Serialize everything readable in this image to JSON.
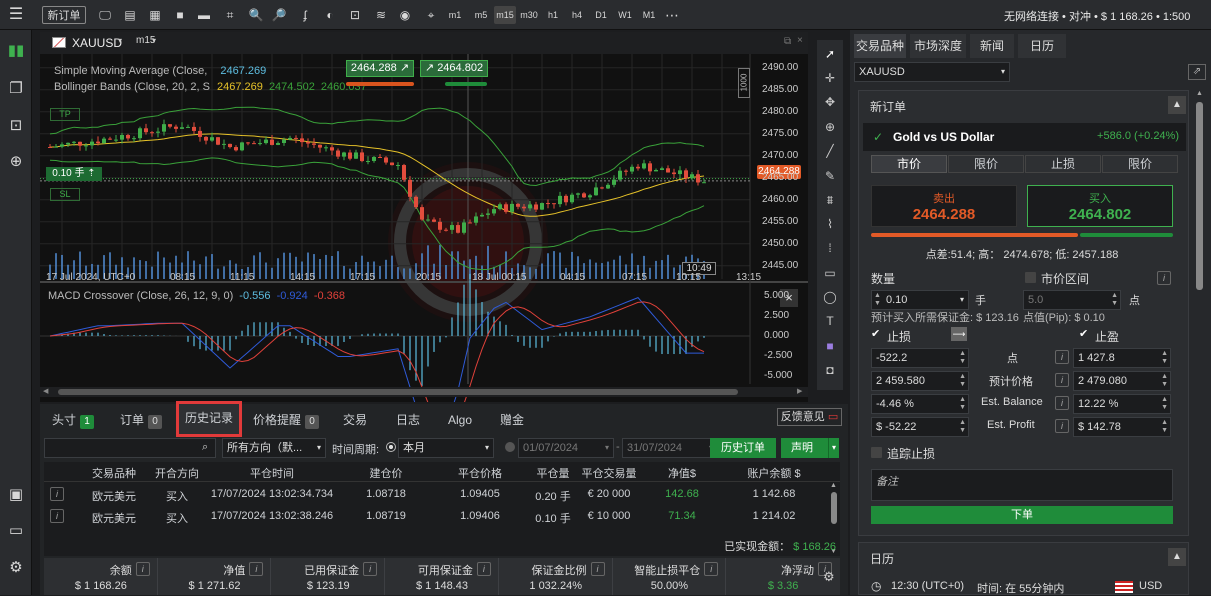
{
  "toolbar": {
    "new_order": "新订单",
    "timeframes": [
      "m1",
      "m5",
      "m15",
      "m30",
      "h1",
      "h4",
      "D1",
      "W1",
      "M1"
    ],
    "more": "⋯",
    "account_status": "无网络连接 • 对冲 • $ 1 168.26 • 1:500"
  },
  "chart": {
    "symbol": "XAUUSD",
    "timeframe": "m15",
    "indicators": {
      "sma": {
        "label": "Simple Moving Average (Close,",
        "value": "2467.269"
      },
      "bb": {
        "label": "Bollinger Bands (Close, 20, 2, S",
        "v1": "2467.269",
        "v2": "2474.502",
        "v3": "2460.037"
      }
    },
    "sell_price": "2464.288",
    "buy_price": "2464.802",
    "qty_label": "0.10 手",
    "tp_label": "TP",
    "sl_label": "SL",
    "current_price_tag": "2464.288",
    "price_scale_label": "1000",
    "y_ticks": [
      "2490.00",
      "2485.00",
      "2480.00",
      "2475.00",
      "2470.00",
      "2465.00",
      "2460.00",
      "2455.00",
      "2450.00",
      "2445.00"
    ],
    "x_ticks": [
      "17 Jul 2024, UTC+0",
      "08:15",
      "11:15",
      "14:15",
      "17:15",
      "20:15",
      "18 Jul 00:15",
      "04:15",
      "07:15",
      "10:15",
      "13:15"
    ],
    "crosshair_time": "10:49",
    "macd": {
      "label": "MACD Crossover (Close, 26, 12, 9, 0)",
      "v1": "-0.556",
      "v2": "-0.924",
      "v3": "-0.368"
    },
    "macd_ticks": [
      "5.000",
      "2.500",
      "0.000",
      "-2.500",
      "-5.000"
    ],
    "colors": {
      "sma": "#e6c229",
      "bb": "#3aa23a",
      "up": "#3fae4a",
      "down": "#e24d3d",
      "macd": "#2f5bd9",
      "signal": "#e0413a",
      "volume": "#4d86c9"
    }
  },
  "bottom": {
    "tabs": [
      {
        "label": "头寸",
        "count": "1"
      },
      {
        "label": "订单",
        "count": "0"
      },
      {
        "label": "历史记录"
      },
      {
        "label": "价格提醒",
        "count": "0"
      },
      {
        "label": "交易"
      },
      {
        "label": "日志"
      },
      {
        "label": "Algo"
      },
      {
        "label": "赠金"
      }
    ],
    "feedback": "反馈意见",
    "filters": {
      "direction": "所有方向（默...",
      "period_label": "时间周期:",
      "period": "本月",
      "date_from": "01/07/2024",
      "date_to": "31/07/2024",
      "history_btn": "历史订单",
      "statement_btn": "声明"
    },
    "columns": [
      "交易品种",
      "开合方向",
      "平仓时间",
      "建仓价",
      "平仓价格",
      "平仓量",
      "平仓交易量",
      "净值$",
      "账户余额 $"
    ],
    "rows": [
      {
        "symbol": "欧元美元",
        "dir": "买入",
        "time": "17/07/2024 13:02:34.734",
        "open": "1.08718",
        "close": "1.09405",
        "qty": "0.20 手",
        "vol": "€ 20 000",
        "pnl": "142.68",
        "bal": "1 142.68"
      },
      {
        "symbol": "欧元美元",
        "dir": "买入",
        "time": "17/07/2024 13:02:38.246",
        "open": "1.08719",
        "close": "1.09406",
        "qty": "0.10 手",
        "vol": "€ 10 000",
        "pnl": "71.34",
        "bal": "1 214.02"
      }
    ],
    "realized_label": "已实现金额：",
    "realized_value": "$ 168.26",
    "summary": [
      {
        "label": "余额",
        "value": "$ 1 168.26"
      },
      {
        "label": "净值",
        "value": "$ 1 271.62"
      },
      {
        "label": "已用保证金",
        "value": "$ 123.19"
      },
      {
        "label": "可用保证金",
        "value": "$ 1 148.43"
      },
      {
        "label": "保证金比例",
        "value": "1 032.24%"
      },
      {
        "label": "智能止损平仓",
        "value": "50.00%"
      },
      {
        "label": "净浮动",
        "value": "$ 3.36"
      }
    ]
  },
  "right": {
    "tabs": [
      "交易品种",
      "市场深度",
      "新闻",
      "日历"
    ],
    "symbol": "XAUUSD",
    "new_order_title": "新订单",
    "instrument_name": "Gold vs US Dollar",
    "change": "+586.0 (+0.24%)",
    "order_types": [
      "市价",
      "限价",
      "止损",
      "限价"
    ],
    "sell_label": "卖出",
    "sell_price": "2464.288",
    "buy_label": "买入",
    "buy_price": "2464.802",
    "spread_info": "点差:51.4; 高： 2474.678; 低: 2457.188",
    "qty_label": "数量",
    "market_range": "市价区间",
    "qty_value": "0.10",
    "qty_unit": "手",
    "range_value": "5.0",
    "range_unit": "点",
    "margin_info": "预计买入所需保证金: $ 123.16",
    "pip_info": "点值(Pip): $ 0.10",
    "sl_label": "止损",
    "tp_label": "止盈",
    "sl_points": "-522.2",
    "tp_points": "1 427.8",
    "points_label": "点",
    "sl_price": "2 459.580",
    "tp_price": "2 479.080",
    "expected_price_label": "预计价格",
    "sl_pct": "-4.46 %",
    "tp_pct": "12.22 %",
    "est_balance_label": "Est. Balance",
    "sl_usd": "$ -52.22",
    "tp_usd": "$ 142.78",
    "est_profit_label": "Est. Profit",
    "trailing_label": "追踪止损",
    "comment_placeholder": "备注",
    "place_order": "下单",
    "calendar_title": "日历",
    "calendar_time": "12:30 (UTC+0)",
    "calendar_when": "时间: 在 55分钟内",
    "calendar_currency": "USD"
  }
}
